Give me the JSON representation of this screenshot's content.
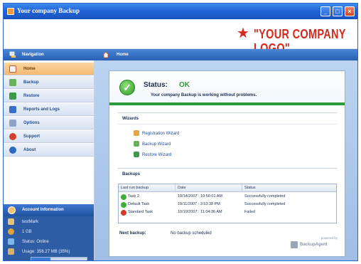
{
  "window": {
    "title": "Your company Backup",
    "controls": {
      "minimize": "_",
      "maximize": "□",
      "close": "×"
    }
  },
  "logo": {
    "star": "★",
    "text": "\"YOUR COMPANY LOGO\""
  },
  "sidebar": {
    "header": "Navigation",
    "items": [
      {
        "label": "Home",
        "active": true,
        "icon": "home-icon"
      },
      {
        "label": "Backup",
        "active": false,
        "icon": "backup-icon"
      },
      {
        "label": "Restore",
        "active": false,
        "icon": "restore-icon"
      },
      {
        "label": "Reports and Logs",
        "active": false,
        "icon": "reports-icon"
      },
      {
        "label": "Options",
        "active": false,
        "icon": "options-icon"
      },
      {
        "label": "Support",
        "active": false,
        "icon": "support-icon"
      },
      {
        "label": "About",
        "active": false,
        "icon": "about-icon"
      }
    ]
  },
  "account": {
    "header": "Account Information",
    "user": "testMark",
    "quota": "1 GB",
    "status": "Status: Online",
    "usage": "Usage: 356.27 MB (35%)",
    "usage_fraction": 0.35
  },
  "main": {
    "header": "Home",
    "status": {
      "label": "Status:",
      "value": "OK",
      "message": "Your company Backup is working without problems."
    },
    "wizards": {
      "title": "Wizards",
      "items": [
        "Registration Wizard",
        "Backup Wizard",
        "Restore Wizard"
      ]
    },
    "backups": {
      "title": "Backups",
      "columns": [
        "Last run backup",
        "Date",
        "Status"
      ],
      "rows": [
        {
          "name": "Task 2",
          "date": "10/14/2007 : 10:56:01 AM",
          "status": "Successfully completed",
          "result": "success"
        },
        {
          "name": "Default Task",
          "date": "10/11/2007 : 3:53:38 PM",
          "status": "Successfully completed",
          "result": "success"
        },
        {
          "name": "Standard Task",
          "date": "10/10/2007 : 11:04:36 AM",
          "status": "Failed",
          "result": "failed"
        }
      ]
    },
    "next_backup": {
      "label": "Next backup:",
      "value": "No backup scheduled"
    },
    "powered": {
      "small": "powered by",
      "name": "BackupAgent"
    }
  },
  "colors": {
    "success": "#2e9b39",
    "failed": "#d63a2a",
    "logo": "#d42a1d",
    "active_nav": "#f5b872"
  }
}
